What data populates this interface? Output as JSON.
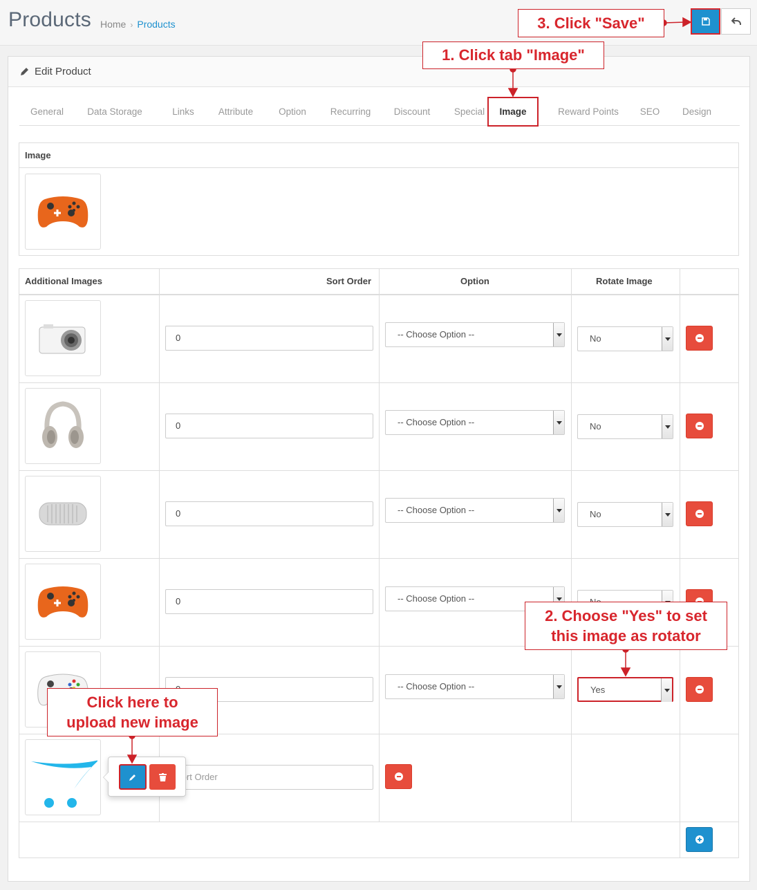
{
  "header": {
    "title": "Products",
    "breadcrumb": [
      "Home",
      "Products"
    ],
    "colors": {
      "primary": "#1e91cf",
      "danger": "#e74c3c",
      "annotation": "#cc2229"
    }
  },
  "panel": {
    "heading": "Edit Product",
    "tabs": [
      "General",
      "Data Storage",
      "Links",
      "Attribute",
      "Option",
      "Recurring",
      "Discount",
      "Special",
      "Image",
      "Reward Points",
      "SEO",
      "Design"
    ],
    "active_tab": "Image"
  },
  "image_section": {
    "header": "Image",
    "thumbnail": "orange-gamepad"
  },
  "additional_images": {
    "columns": [
      "Additional Images",
      "Sort Order",
      "Option",
      "Rotate Image"
    ],
    "rows": [
      {
        "thumbnail": "white-camera",
        "sort_order": "0",
        "option": "-- Choose Option --",
        "rotate": "No"
      },
      {
        "thumbnail": "headphones",
        "sort_order": "0",
        "option": "-- Choose Option --",
        "rotate": "No"
      },
      {
        "thumbnail": "speaker",
        "sort_order": "0",
        "option": "-- Choose Option --",
        "rotate": "No"
      },
      {
        "thumbnail": "orange-gamepad",
        "sort_order": "0",
        "option": "-- Choose Option --",
        "rotate": "No"
      },
      {
        "thumbnail": "white-gamepad",
        "sort_order": "0",
        "option": "-- Choose Option --",
        "rotate": "Yes"
      }
    ],
    "new_row": {
      "thumbnail": "opencart-logo",
      "sort_order_placeholder": "Sort Order"
    }
  },
  "annotations": {
    "step1": "1. Click tab \"Image\"",
    "step2_line1": "2. Choose \"Yes\" to set",
    "step2_line2": "this image as rotator",
    "step3": "3. Click \"Save\"",
    "upload_line1": "Click here to",
    "upload_line2": "upload new image"
  },
  "icons": {
    "save": "floppy-disk-icon",
    "back": "reply-icon",
    "edit": "pencil-icon",
    "remove": "minus-circle-icon",
    "add": "plus-circle-icon",
    "trash": "trash-icon"
  }
}
